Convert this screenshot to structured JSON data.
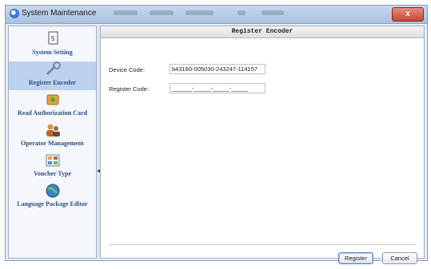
{
  "window": {
    "title": "System Maintenance",
    "close_label": "x"
  },
  "sidebar": {
    "items": [
      {
        "label": "System Setting",
        "icon": "document-icon",
        "active": false
      },
      {
        "label": "Register Encoder",
        "icon": "wrench-icon",
        "active": true
      },
      {
        "label": "Read Authorization Card",
        "icon": "card-reader-icon",
        "active": false
      },
      {
        "label": "Operator Management",
        "icon": "users-icon",
        "active": false
      },
      {
        "label": "Voucher Type",
        "icon": "voucher-icon",
        "active": false
      },
      {
        "label": "Language Package Editor",
        "icon": "globe-icon",
        "active": false
      }
    ]
  },
  "main": {
    "header": "Register Encoder",
    "device_code_label": "Device Code:",
    "device_code_value": "b43160-005030-243247-114157",
    "register_code_label": "Register Code:",
    "register_code_value": "______-_____-_____-_____",
    "register_button": "Register",
    "cancel_button": "Cancel"
  },
  "colors": {
    "accent": "#2f4f82",
    "active_bg": "#bcd2ee",
    "close_red": "#c24a35"
  }
}
